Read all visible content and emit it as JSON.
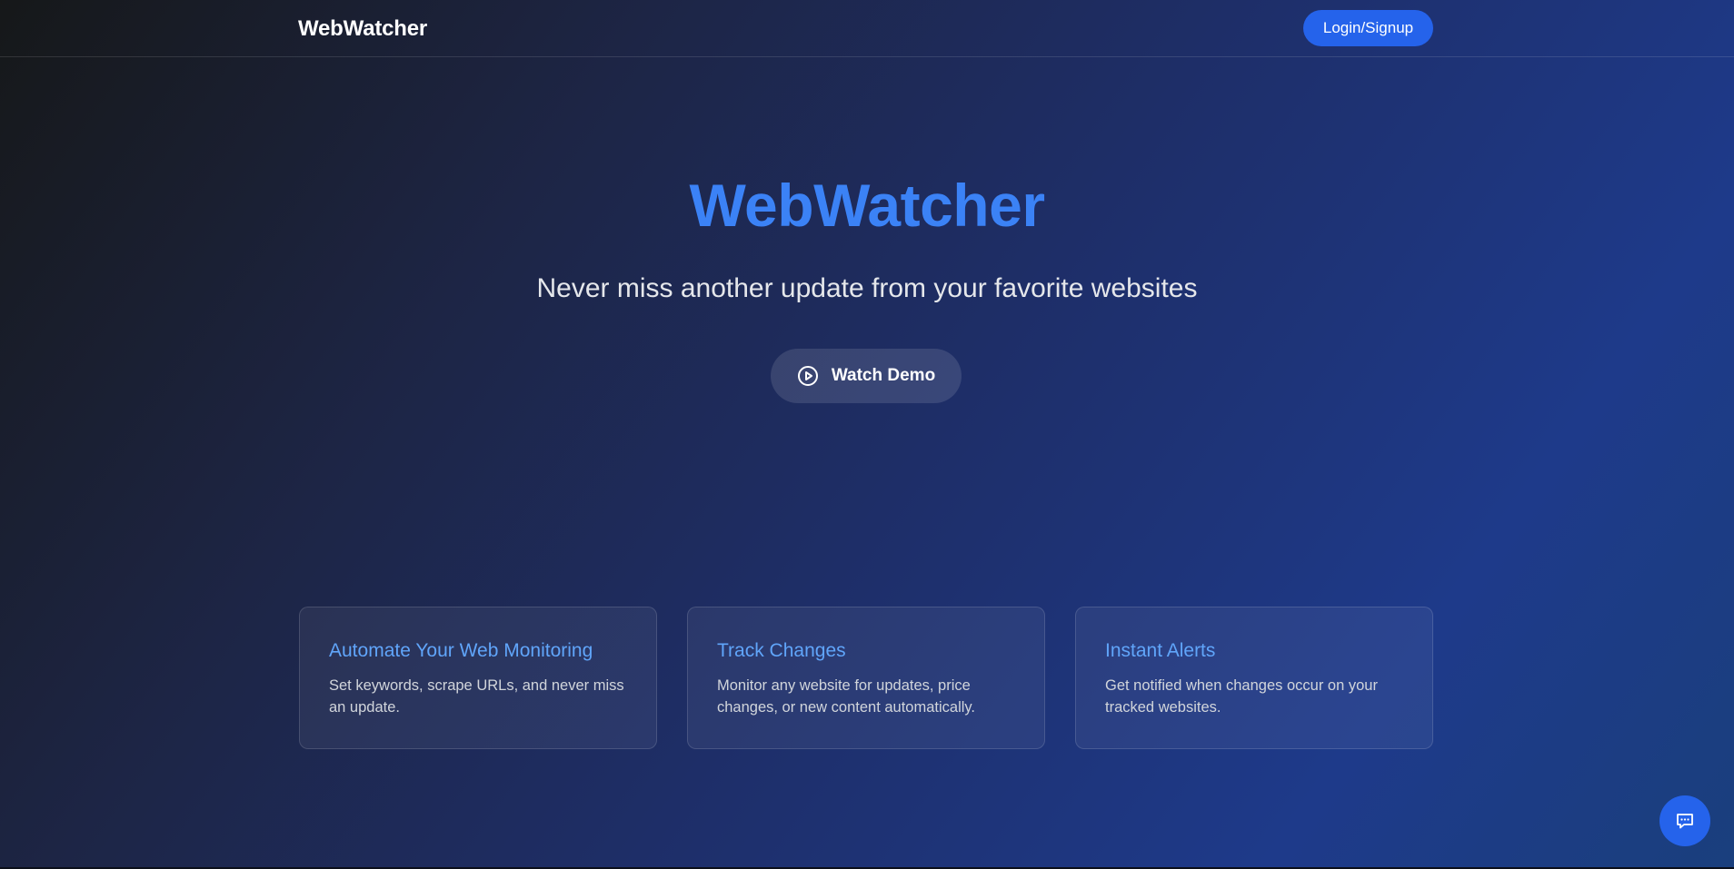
{
  "header": {
    "brand": "WebWatcher",
    "login_label": "Login/Signup"
  },
  "hero": {
    "title": "WebWatcher",
    "subtitle": "Never miss another update from your favorite websites",
    "demo_label": "Watch Demo",
    "demo_icon": "play-circle-icon"
  },
  "features": [
    {
      "title": "Automate Your Web Monitoring",
      "text": "Set keywords, scrape URLs, and never miss an update."
    },
    {
      "title": "Track Changes",
      "text": "Monitor any website for updates, price changes, or new content automatically."
    },
    {
      "title": "Instant Alerts",
      "text": "Get notified when changes occur on your tracked websites."
    }
  ],
  "chat": {
    "icon": "chat-bubble-icon"
  },
  "colors": {
    "accent": "#2563eb",
    "title_blue": "#3b82f6",
    "card_title": "#60a5fa"
  }
}
